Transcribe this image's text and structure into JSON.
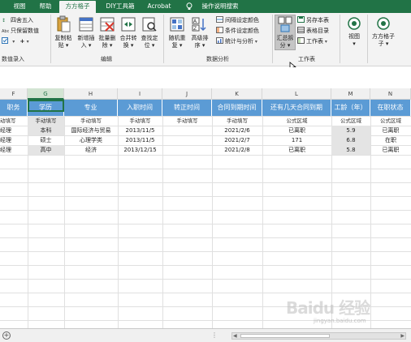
{
  "tabs": [
    {
      "label": "视图",
      "active": false
    },
    {
      "label": "帮助",
      "active": false
    },
    {
      "label": "方方格子",
      "active": true
    },
    {
      "label": "DIY工具箱",
      "active": false
    },
    {
      "label": "Acrobat",
      "active": false
    },
    {
      "label": "操作说明搜索",
      "active": false
    }
  ],
  "ribbon": {
    "left_group": {
      "round_label": "四舍五入",
      "keep_value_label": "只保留数值",
      "label": "数值录入"
    },
    "edit_group": {
      "label": "编辑",
      "buttons": [
        {
          "line1": "复制粘",
          "line2": "贴"
        },
        {
          "line1": "新增插",
          "line2": "入"
        },
        {
          "line1": "批量删",
          "line2": "除"
        },
        {
          "line1": "合并转",
          "line2": "换"
        },
        {
          "line1": "查找定",
          "line2": "位"
        }
      ]
    },
    "analysis_group": {
      "label": "数据分析",
      "buttons": [
        {
          "line1": "随机重",
          "line2": "复"
        },
        {
          "line1": "高级排",
          "line2": "序"
        }
      ],
      "small": [
        "间隔设定颜色",
        "条件设定颜色",
        "统计与分析"
      ]
    },
    "worksheet_group": {
      "label": "工作表",
      "big": {
        "line1": "汇总拆",
        "line2": "分"
      },
      "small": [
        "另存本表",
        "表格目录",
        "工作表"
      ]
    },
    "view_label": "视图",
    "ffgz_label": "方方格子",
    "ffgz_label2": "子"
  },
  "columns": [
    "F",
    "G",
    "H",
    "I",
    "J",
    "K",
    "L",
    "M",
    "N"
  ],
  "table": {
    "headers": [
      "职务",
      "学历",
      "专业",
      "入职时间",
      "转正时间",
      "合同到期时间",
      "还有几天合同到期",
      "工龄（年）",
      "在职状态"
    ],
    "subheaders": [
      "动填写",
      "手动填写",
      "手动填写",
      "手动填写",
      "手动填写",
      "手动填写",
      "公式区域",
      "公式区域",
      "公式区域"
    ],
    "rows": [
      [
        "经理",
        "本科",
        "国际经济与贸易",
        "2013/11/5",
        "",
        "2021/2/6",
        "已离职",
        "5.9",
        "已离职"
      ],
      [
        "经理",
        "硕士",
        "心理学类",
        "2013/11/5",
        "",
        "2021/2/7",
        "171",
        "6.8",
        "在职"
      ],
      [
        "经理",
        "高中",
        "经济",
        "2013/12/15",
        "",
        "2021/2/8",
        "已离职",
        "5.8",
        "已离职"
      ]
    ]
  },
  "watermark": {
    "text": "Baidu 经验",
    "sub": "jingyan.baidu.com"
  },
  "colors": {
    "ribbon_green": "#217346",
    "header_blue": "#5b9bd5"
  }
}
